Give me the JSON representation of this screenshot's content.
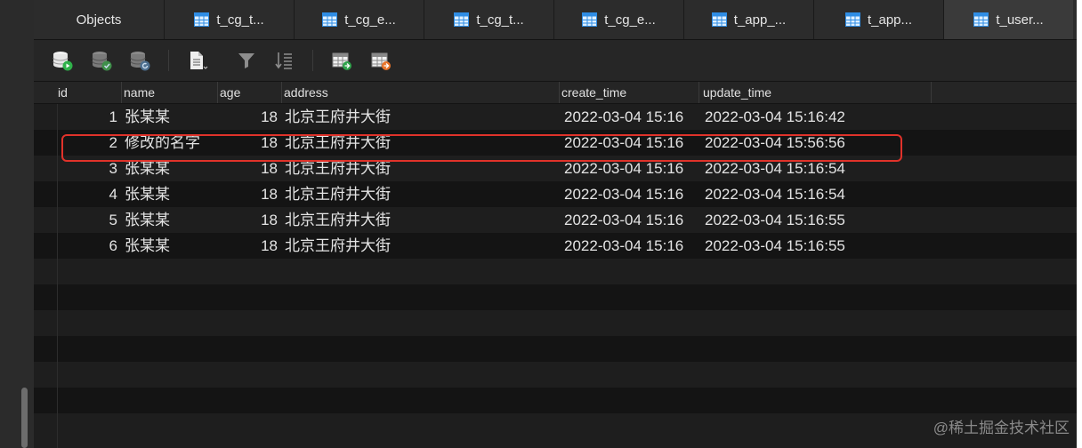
{
  "tabs": [
    {
      "label": "Objects",
      "icon": "objects",
      "active": false
    },
    {
      "label": "t_cg_t...",
      "icon": "table-icon",
      "active": false
    },
    {
      "label": "t_cg_e...",
      "icon": "table-icon",
      "active": false
    },
    {
      "label": "t_cg_t...",
      "icon": "table-icon",
      "active": false
    },
    {
      "label": "t_cg_e...",
      "icon": "table-icon",
      "active": false
    },
    {
      "label": "t_app_...",
      "icon": "table-icon",
      "active": false
    },
    {
      "label": "t_app...",
      "icon": "table-icon",
      "active": false
    },
    {
      "label": "t_user...",
      "icon": "table-icon",
      "active": true
    }
  ],
  "toolbar": {
    "icons": [
      "begin-transaction-icon",
      "commit-icon",
      "rollback-icon",
      "text-view-icon",
      "filter-icon",
      "sort-icon",
      "import-icon",
      "export-icon"
    ]
  },
  "columns": [
    "id",
    "name",
    "age",
    "address",
    "create_time",
    "update_time"
  ],
  "rows": [
    {
      "id": "1",
      "name": "张某某",
      "age": "18",
      "address": "北京王府井大街",
      "create_time": "2022-03-04 15:16",
      "update_time": "2022-03-04 15:16:42"
    },
    {
      "id": "2",
      "name": "修改的名字",
      "age": "18",
      "address": "北京王府井大街",
      "create_time": "2022-03-04 15:16",
      "update_time": "2022-03-04 15:56:56"
    },
    {
      "id": "3",
      "name": "张某某",
      "age": "18",
      "address": "北京王府井大街",
      "create_time": "2022-03-04 15:16",
      "update_time": "2022-03-04 15:16:54"
    },
    {
      "id": "4",
      "name": "张某某",
      "age": "18",
      "address": "北京王府井大街",
      "create_time": "2022-03-04 15:16",
      "update_time": "2022-03-04 15:16:54"
    },
    {
      "id": "5",
      "name": "张某某",
      "age": "18",
      "address": "北京王府井大街",
      "create_time": "2022-03-04 15:16",
      "update_time": "2022-03-04 15:16:55"
    },
    {
      "id": "6",
      "name": "张某某",
      "age": "18",
      "address": "北京王府井大街",
      "create_time": "2022-03-04 15:16",
      "update_time": "2022-03-04 15:16:55"
    }
  ],
  "highlighted_row_index": 1,
  "highlight_color": "#e0322a",
  "watermark": "@稀土掘金技术社区"
}
